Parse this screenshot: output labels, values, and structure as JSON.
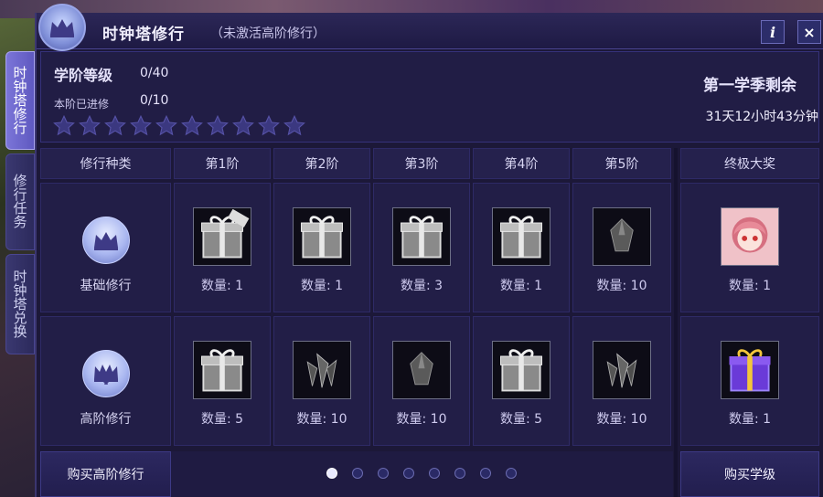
{
  "window": {
    "title": "时钟塔修行",
    "subtitle": "（未激活高阶修行）",
    "info_label": "i",
    "close_label": "×"
  },
  "sidetabs": [
    {
      "label": "时钟塔修行",
      "active": true
    },
    {
      "label": "修行任务",
      "active": false
    },
    {
      "label": "时钟塔兑换",
      "active": false
    }
  ],
  "progress": {
    "level_label": "学阶等级",
    "level_value": "0/40",
    "advanced_label": "本阶已进修",
    "advanced_value": "0/10",
    "stars_filled": 0,
    "stars_total": 10
  },
  "season": {
    "label": "第一学季剩余",
    "remaining": "31天12小时43分钟"
  },
  "table": {
    "headers": [
      "修行种类",
      "第1阶",
      "第2阶",
      "第3阶",
      "第4阶",
      "第5阶",
      "终极大奖"
    ],
    "rows": [
      {
        "type": "基础修行",
        "rewards": [
          {
            "icon": "silver-gift-new-icon",
            "qty": "数量: 1"
          },
          {
            "icon": "silver-gift-icon",
            "qty": "数量: 1"
          },
          {
            "icon": "silver-gift-icon",
            "qty": "数量: 3"
          },
          {
            "icon": "silver-gift-icon",
            "qty": "数量: 1"
          },
          {
            "icon": "dark-crystal-icon",
            "qty": "数量: 10"
          }
        ],
        "grand": {
          "icon": "anime-girl-portrait-icon",
          "qty": "数量: 1"
        }
      },
      {
        "type": "高阶修行",
        "rewards": [
          {
            "icon": "silver-gift-icon",
            "qty": "数量: 5"
          },
          {
            "icon": "crystal-cluster-icon",
            "qty": "数量: 10"
          },
          {
            "icon": "dark-crystal-icon",
            "qty": "数量: 10"
          },
          {
            "icon": "silver-gift-icon",
            "qty": "数量: 5"
          },
          {
            "icon": "crystal-cluster-icon",
            "qty": "数量: 10"
          }
        ],
        "grand": {
          "icon": "purple-gift-icon",
          "qty": "数量: 1"
        }
      }
    ]
  },
  "buttons": {
    "buy_advanced": "购买高阶修行",
    "buy_level": "购买学级"
  },
  "pagination": {
    "total": 8,
    "current": 1
  },
  "colors": {
    "accent": "#6f69d0",
    "panel": "#221e47",
    "gold": "#f3c63b",
    "purple_gift": "#6a3ad8"
  }
}
